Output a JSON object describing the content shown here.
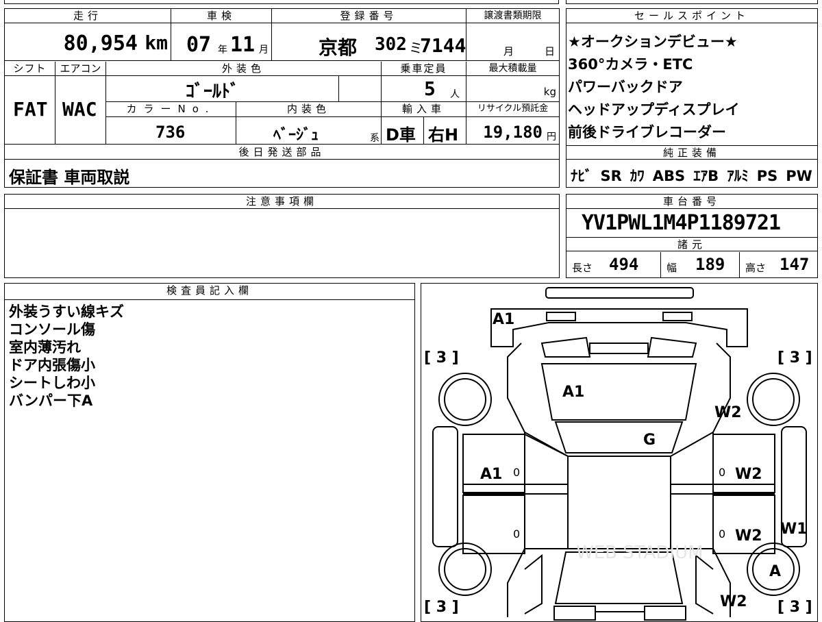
{
  "sheet": {
    "mileage": {
      "label": "走行",
      "value": "80,954",
      "unit": "km"
    },
    "inspection": {
      "label": "車検",
      "year": "07",
      "year_unit": "年",
      "month": "11",
      "month_unit": "月"
    },
    "registration": {
      "label": "登録番号",
      "region": "京都",
      "class": "302",
      "kana": "ミ",
      "number": "7144"
    },
    "transfer": {
      "label": "譲渡書類期限",
      "month_unit": "月",
      "day_unit": "日"
    },
    "shift": {
      "label": "シフト",
      "value": "FAT"
    },
    "aircon": {
      "label": "エアコン",
      "value": "WAC"
    },
    "exterior_color": {
      "label": "外装色",
      "value": "ｺﾞｰﾙﾄﾞ"
    },
    "capacity": {
      "label": "乗車定員",
      "value": "5",
      "unit": "人"
    },
    "max_load": {
      "label": "最大積載量",
      "unit": "kg"
    },
    "color_no": {
      "label": "カラーNo.",
      "value": "736"
    },
    "interior_color": {
      "label": "内装色",
      "value": "ﾍﾞｰｼﾞｭ",
      "suffix": "系"
    },
    "import": {
      "label": "輸入車",
      "dealer": "D車",
      "steering": "右H"
    },
    "recycle": {
      "label": "リサイクル預託金",
      "value": "19,180",
      "unit": "円"
    },
    "later_parts": {
      "label": "後日発送部品",
      "value": "保証書 車両取説"
    },
    "notes": {
      "label": "注意事項欄",
      "value": ""
    },
    "inspector": {
      "label": "検査員記入欄",
      "lines": [
        "外装うすい線キズ",
        "コンソール傷",
        "室内薄汚れ",
        "ドア内張傷小",
        "シートしわ小",
        "バンパー下A"
      ]
    }
  },
  "sales_points": {
    "label": "セールスポイント",
    "items": [
      "★オークションデビュー★",
      "360°カメラ・ETC",
      "パワーバックドア",
      "ヘッドアップディスプレイ",
      "前後ドライブレコーダー"
    ]
  },
  "genuine_equipment": {
    "label": "純正装備",
    "items": [
      "ﾅﾋﾞ",
      "SR",
      "ｶﾜ",
      "ABS",
      "ｴｱB",
      "ｱﾙﾐ",
      "PS",
      "PW"
    ]
  },
  "chassis": {
    "label": "車台番号",
    "value": "YV1PWL1M4P1189721"
  },
  "specs": {
    "label": "諸元",
    "length_label": "長さ",
    "length": "494",
    "width_label": "幅",
    "width": "189",
    "height_label": "高さ",
    "height": "147"
  },
  "diagram": {
    "tire_counts": [
      "[ 3 ]",
      "[ 3 ]",
      "[ 3 ]",
      "[ 3 ]"
    ],
    "marks": {
      "roof_front": "A1",
      "hood": "A1",
      "fl_fender": "W2",
      "windshield": "G",
      "lf_door": "A1",
      "rf_door": "W2",
      "rr_door": "W2",
      "r_quarter": "W1",
      "r_wheel": "A",
      "rear_right": "W2"
    },
    "zeros": [
      "0",
      "0",
      "0",
      "0"
    ],
    "watermark": "WEB STADIUM"
  }
}
